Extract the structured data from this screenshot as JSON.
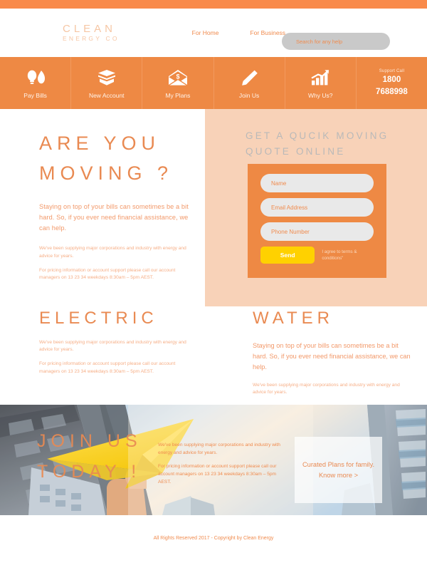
{
  "brand": {
    "name_line1": "CLEAN",
    "name_line2": "ENERGY CO"
  },
  "header": {
    "links": [
      {
        "label": "For Home"
      },
      {
        "label": "For Business"
      }
    ],
    "search_placeholder": "Search for any help"
  },
  "navbar": {
    "items": [
      {
        "label": "Pay Bills",
        "icon": "bulb-flame-icon"
      },
      {
        "label": "New Account",
        "icon": "open-box-icon"
      },
      {
        "label": "My Plans",
        "icon": "envelope-dollar-icon"
      },
      {
        "label": "Join Us",
        "icon": "pencil-icon"
      },
      {
        "label": "Why Us?",
        "icon": "bar-chart-arrow-icon"
      }
    ],
    "support": {
      "label": "Support Call",
      "number_line1": "1800",
      "number_line2": "7688998"
    }
  },
  "hero": {
    "heading_line1": "ARE YOU",
    "heading_line2": "MOVING ?",
    "lead": "Staying on top of your bills can sometimes be a bit hard. So, if you ever need financial assistance, we can help.",
    "small1": "We've been supplying major corporations and industry with energy and advice for years.",
    "small2": "For pricing information or account support please call our account managers on 13 23 34 weekdays 8:30am – 5pm AEST."
  },
  "quote": {
    "title_line1": "GET A QUCIK MOVING",
    "title_line2": "QUOTE ONLINE",
    "fields": [
      {
        "placeholder": "Name",
        "value": ""
      },
      {
        "placeholder": "Email Address",
        "value": ""
      },
      {
        "placeholder": "Phone Number",
        "value": ""
      }
    ],
    "send_label": "Send",
    "terms": "I agree to terms & conditions\""
  },
  "sections": {
    "electric": {
      "heading": "ELECTRIC",
      "small1": "We've been supplying major corporations and industry with energy and advice for years.",
      "small2": "For pricing information or account support please call our account managers on 13 23 34 weekdays 8:30am – 5pm AEST."
    },
    "water": {
      "heading": "WATER",
      "lead": "Staying on top of your bills can sometimes be a bit hard. So, if you ever need financial assistance, we can help.",
      "small1": "We've been supplying major corporations and industry with energy and advice for years."
    }
  },
  "photoband": {
    "heading_line1": "JOIN US",
    "heading_line2": "TODAY !",
    "small1": "We've been supplying major corporations and industry with energy and advice for years.",
    "small2": "For pricing information or account support please call our account managers on 13 23 34 weekdays 8:30am – 5pm AEST.",
    "cta": "Curated Plans for family. Know more >"
  },
  "footer": {
    "copyright": "All Rights Reserved 2017 - Copyright by Clean Energy"
  },
  "colors": {
    "accent_bar": "#F98A4A",
    "nav_orange": "#EE8944",
    "peach_panel": "#F8D2B8",
    "send_yellow": "#FFD100",
    "text_orange": "#E98A52",
    "muted_orange": "#F6AE86",
    "search_grey": "#C9C9C9"
  }
}
